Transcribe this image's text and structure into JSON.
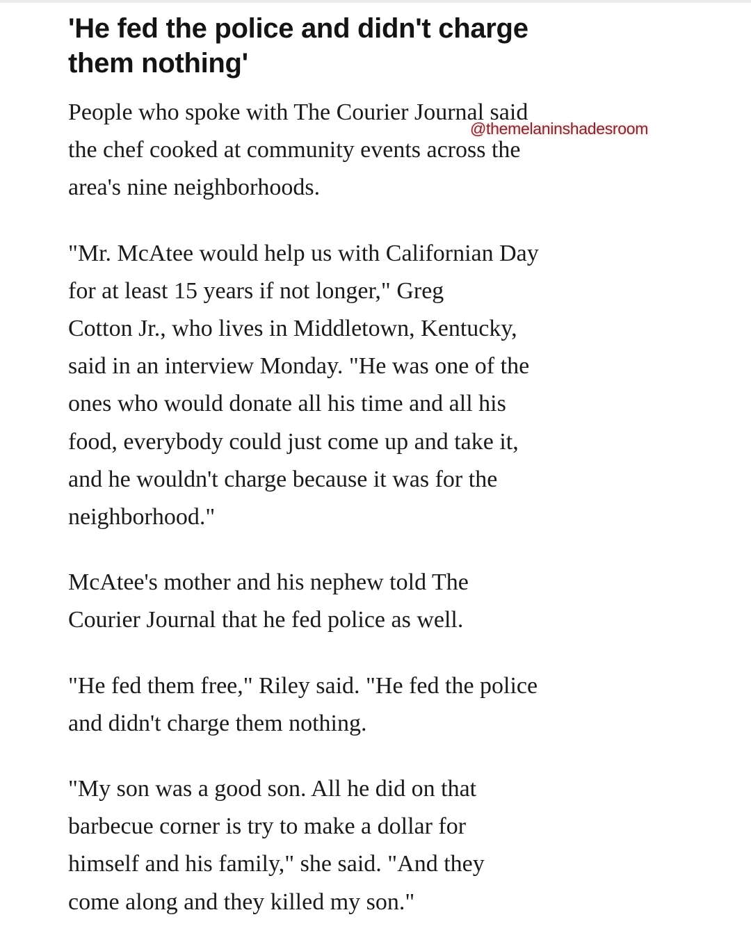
{
  "headline": {
    "lines": [
      "'He fed the police and didn't charge",
      "them nothing'"
    ]
  },
  "watermark": "@themelaninshadesroom",
  "paragraphs": [
    {
      "lines": [
        "People who spoke with The Courier Journal said",
        "the chef  cooked at community events across the",
        "area's nine neighborhoods."
      ]
    },
    {
      "lines": [
        "\"Mr. McAtee would help us with Californian Day",
        "for at least 15 years if not longer,\" Greg",
        "Cotton Jr., who lives in Middletown, Kentucky,",
        "said in an interview Monday. \"He was one of the",
        "ones who would donate all his time and all his",
        "food, everybody could just come up and take it,",
        "and he wouldn't charge because it was for the",
        "neighborhood.\""
      ]
    },
    {
      "lines": [
        "McAtee's mother and his nephew told The",
        "Courier Journal that he fed police as well."
      ]
    },
    {
      "lines": [
        "\"He fed them free,\" Riley said. \"He fed the police",
        "and didn't charge them nothing."
      ]
    },
    {
      "lines": [
        "\"My son was a good son. All he did on that",
        "barbecue corner is try to make a dollar for",
        "himself and his family,\" she said. \"And they",
        "come along and they killed my son.\""
      ]
    }
  ]
}
